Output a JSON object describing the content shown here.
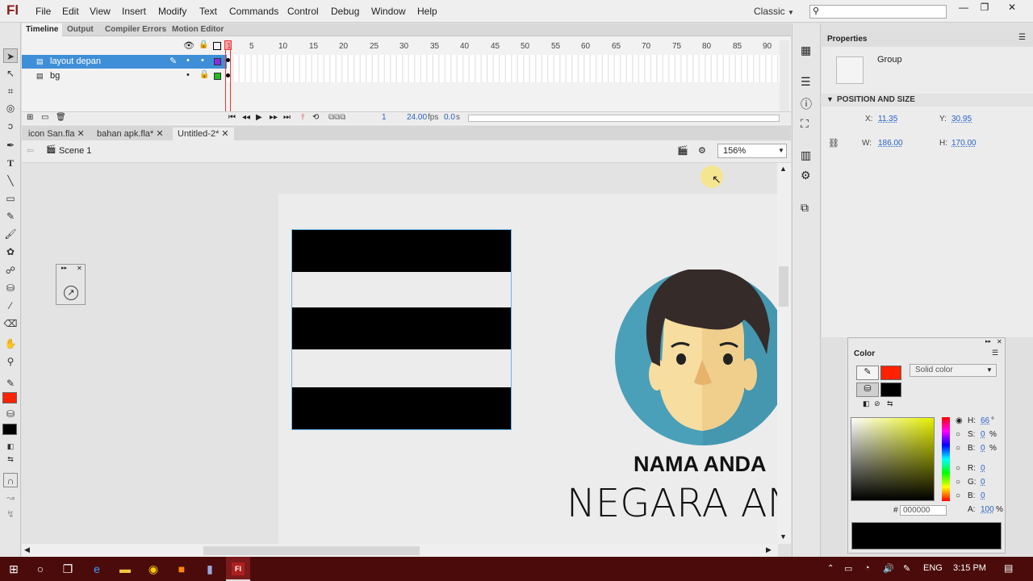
{
  "app": {
    "logo": "Fl"
  },
  "menu": [
    "File",
    "Edit",
    "View",
    "Insert",
    "Modify",
    "Text",
    "Commands",
    "Control",
    "Debug",
    "Window",
    "Help"
  ],
  "workspace": "Classic",
  "timeline": {
    "tabs": [
      "Timeline",
      "Output",
      "Compiler Errors",
      "Motion Editor"
    ],
    "layers": [
      {
        "name": "layout depan",
        "color": "#8a2be2"
      },
      {
        "name": "bg",
        "color": "#22bb22"
      }
    ],
    "frame_numbers": [
      "1",
      "5",
      "10",
      "15",
      "20",
      "25",
      "30",
      "35",
      "40",
      "45",
      "50",
      "55",
      "60",
      "65",
      "70",
      "75",
      "80",
      "85",
      "90"
    ],
    "current_frame": "1",
    "fps": "24.00",
    "fps_unit": "fps",
    "time": "0.0",
    "time_unit": "s"
  },
  "documents": [
    "icon San.fla",
    "bahan apk.fla*",
    "Untitled-2*"
  ],
  "scene": "Scene 1",
  "zoom": "156%",
  "stage": {
    "name": "NAMA ANDA",
    "country": "NEGARA AN"
  },
  "properties": {
    "title": "Properties",
    "instance_type": "Group",
    "section": "POSITION AND SIZE",
    "x_label": "X:",
    "x": "11.35",
    "y_label": "Y:",
    "y": "30.95",
    "w_label": "W:",
    "w": "186.00",
    "h_label": "H:",
    "h": "170.00"
  },
  "color_panel": {
    "title": "Color",
    "type": "Solid color",
    "stroke_color": "#ff2200",
    "fill_color": "#000000",
    "hsb": [
      {
        "label": "H:",
        "value": "66",
        "unit": "°"
      },
      {
        "label": "S:",
        "value": "0",
        "unit": "%"
      },
      {
        "label": "B:",
        "value": "0",
        "unit": "%"
      }
    ],
    "rgb": [
      {
        "label": "R:",
        "value": "0"
      },
      {
        "label": "G:",
        "value": "0"
      },
      {
        "label": "B:",
        "value": "0"
      }
    ],
    "hex_label": "#",
    "hex": "000000",
    "alpha_label": "A:",
    "alpha": "100",
    "alpha_unit": "%"
  },
  "taskbar": {
    "lang": "ENG",
    "time": "3:15 PM"
  }
}
